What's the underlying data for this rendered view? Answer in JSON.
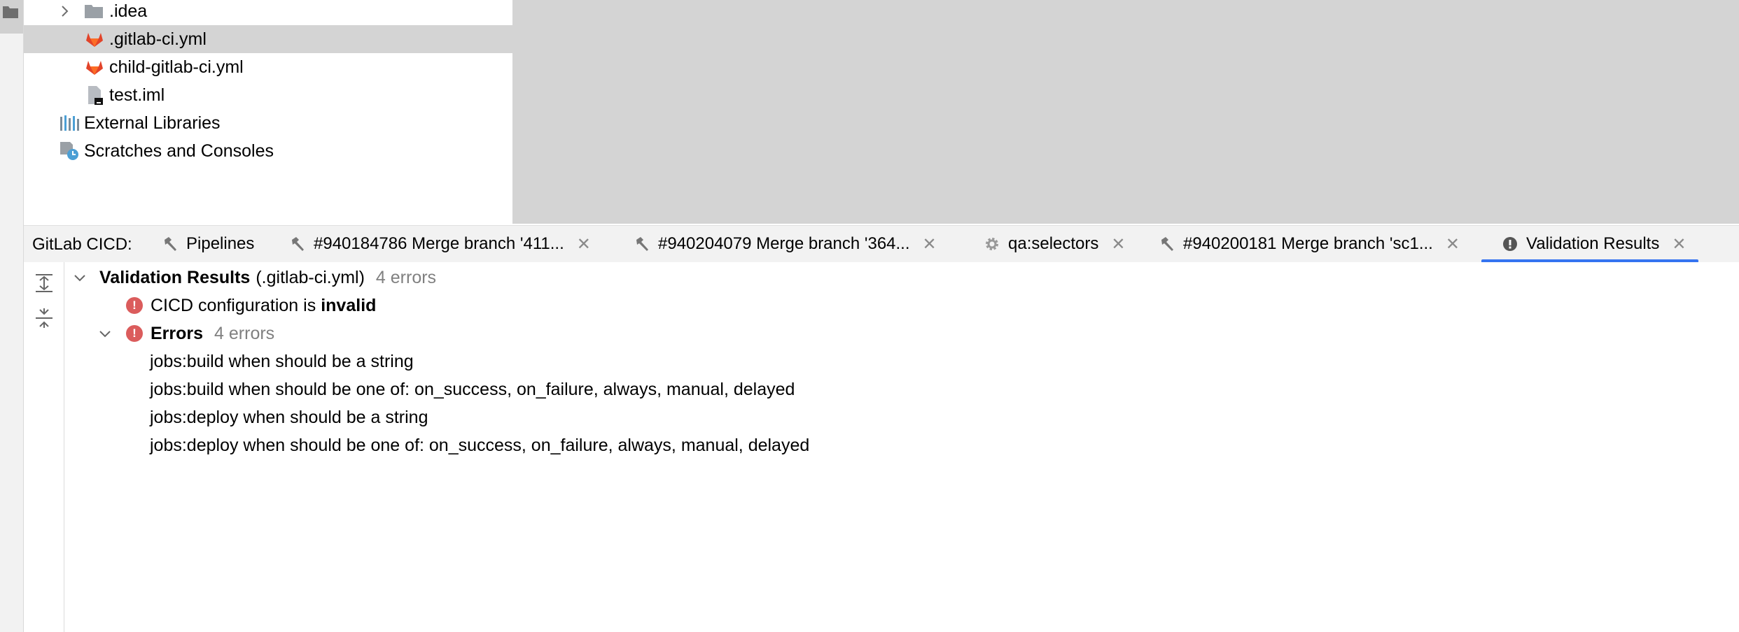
{
  "project_tree": {
    "items": [
      {
        "label": ".idea",
        "icon": "folder-icon"
      },
      {
        "label": ".gitlab-ci.yml",
        "icon": "gitlab-icon",
        "selected": true
      },
      {
        "label": "child-gitlab-ci.yml",
        "icon": "gitlab-icon"
      },
      {
        "label": "test.iml",
        "icon": "iml-file-icon"
      },
      {
        "label": "External Libraries",
        "icon": "libraries-icon"
      },
      {
        "label": "Scratches and Consoles",
        "icon": "scratches-icon"
      }
    ]
  },
  "tool_window": {
    "title": "GitLab CICD:",
    "tabs": [
      {
        "label": "Pipelines",
        "icon": "hammer-icon",
        "closable": false
      },
      {
        "label": "#940184786 Merge branch '411...",
        "icon": "hammer-icon",
        "closable": true
      },
      {
        "label": "#940204079 Merge branch '364...",
        "icon": "hammer-icon",
        "closable": true
      },
      {
        "label": "qa:selectors",
        "icon": "gear-icon",
        "closable": true
      },
      {
        "label": "#940200181 Merge branch 'sc1...",
        "icon": "hammer-icon",
        "closable": true
      },
      {
        "label": "Validation Results",
        "icon": "error-icon",
        "closable": true,
        "active": true
      }
    ],
    "close_glyph": "✕"
  },
  "results": {
    "root_label": "Validation Results",
    "root_file": "(.gitlab-ci.yml)",
    "root_count": "4 errors",
    "config_prefix": "CICD configuration is",
    "config_status": "invalid",
    "errors_label": "Errors",
    "errors_count": "4 errors",
    "error_messages": [
      "jobs:build when should be a string",
      "jobs:build when should be one of: on_success, on_failure, always, manual, delayed",
      "jobs:deploy when should be a string",
      "jobs:deploy when should be one of: on_success, on_failure, always, manual, delayed"
    ]
  },
  "colors": {
    "error": "#db5c5c",
    "active_tab_underline": "#3574f0",
    "gitlab_orange": "#e24329",
    "selection": "#d4d4d4"
  }
}
